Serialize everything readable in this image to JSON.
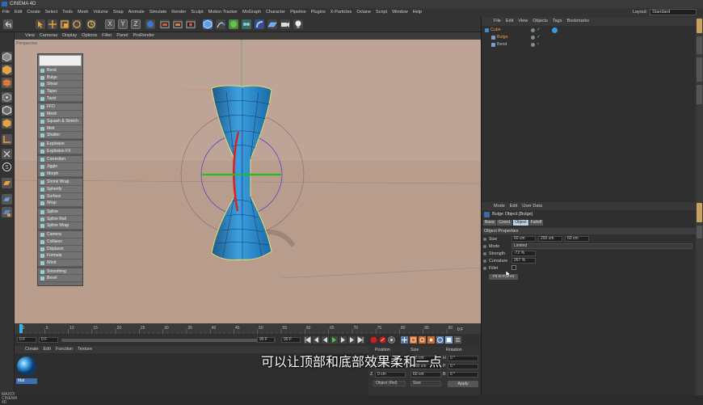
{
  "window": {
    "title": "CINEMA 4D"
  },
  "menubar": {
    "items": [
      "File",
      "Edit",
      "Create",
      "Select",
      "Tools",
      "Mesh",
      "Volume",
      "Snap",
      "Animate",
      "Simulate",
      "Render",
      "Sculpt",
      "Motion Tracker",
      "MoGraph",
      "Character",
      "Pipeline",
      "Plugins",
      "X-Particles",
      "Octane",
      "Script",
      "Window",
      "Help"
    ],
    "layout_label": "Layout:",
    "layout_value": "Standard"
  },
  "toolbar": {
    "axis_x": "X",
    "axis_y": "Y",
    "axis_z": "Z"
  },
  "viewport": {
    "menu": [
      "View",
      "Cameras",
      "Display",
      "Options",
      "Filter",
      "Panel",
      "ProRender"
    ],
    "label": "Perspective"
  },
  "deformer_menu": {
    "groups": [
      [
        "Bend",
        "Bulge",
        "Shear",
        "Taper",
        "Twist"
      ],
      [
        "FFD",
        "Mesh",
        "Squash & Stretch",
        "Melt",
        "Shatter"
      ],
      [
        "Explosion",
        "Explosion FX"
      ],
      [
        "Correction",
        "Jiggle",
        "Morph"
      ],
      [
        "Shrink Wrap",
        "Spherify",
        "Surface",
        "Wrap"
      ],
      [
        "Spline",
        "Spline Rail",
        "Spline Wrap"
      ],
      [
        "Camera",
        "Collision",
        "Displacer",
        "Formula",
        "Wind"
      ],
      [
        "Smoothing",
        "Bevel"
      ]
    ]
  },
  "timeline": {
    "ticks": [
      "0",
      "5",
      "10",
      "15",
      "20",
      "25",
      "30",
      "35",
      "40",
      "45",
      "50",
      "55",
      "60",
      "65",
      "70",
      "75",
      "80",
      "85",
      "90"
    ],
    "end_label": "0 F",
    "start_field": "0 F",
    "min_field": "0 F",
    "max_field": "90 F",
    "end_field": "90 F"
  },
  "materials": {
    "menu": [
      "Create",
      "Edit",
      "Function",
      "Texture"
    ],
    "swatch_label": "Mat"
  },
  "coords": {
    "headers": [
      "Position",
      "Size",
      "Rotation"
    ],
    "rows": [
      {
        "axis": "X",
        "pos": "0 cm",
        "size": "60 cm",
        "rot_axis": "H",
        "rot": "0 °"
      },
      {
        "axis": "Y",
        "pos": "0 cm",
        "size": "200 cm",
        "rot_axis": "P",
        "rot": "0 °"
      },
      {
        "axis": "Z",
        "pos": "0 cm",
        "size": "60 cm",
        "rot_axis": "B",
        "rot": "0 °"
      }
    ],
    "mode": "Object (Rel)",
    "size_mode": "Size",
    "apply_label": "Apply"
  },
  "object_manager": {
    "menu": [
      "File",
      "Edit",
      "View",
      "Objects",
      "Tags",
      "Bookmarks"
    ],
    "objects": [
      {
        "name": "Cube",
        "indent": 0,
        "color": "#e8a040"
      },
      {
        "name": "Bulge",
        "indent": 1,
        "color": "#e8a040"
      },
      {
        "name": "Bend",
        "indent": 1,
        "color": "#aabbdd"
      }
    ]
  },
  "attributes": {
    "menu": [
      "Mode",
      "Edit",
      "User Data"
    ],
    "title": "Bulge Object [Bulge]",
    "tabs": [
      "Basic",
      "Coord.",
      "Object",
      "Falloff"
    ],
    "active_tab": "Object",
    "section": "Object Properties",
    "props": {
      "size_label": "Size",
      "size_x": "60 cm",
      "size_y": "200 cm",
      "size_z": "60 cm",
      "mode_label": "Mode",
      "mode_value": "Limited",
      "strength_label": "Strength",
      "strength_value": "-72 %",
      "curvature_label": "Curvature",
      "curvature_value": "267 %",
      "fillet_label": "Fillet"
    },
    "fit_button": "Fit to Parent"
  },
  "branding": {
    "maxon": "MAXON CINEMA 4D"
  },
  "subtitle": "可以让顶部和底部效果柔和一点",
  "colors": {
    "viewport_bg": "#b99d8c",
    "mesh_blue": "#2e8fd0",
    "accent_orange": "#e8a040",
    "active_tab": "#bdd1e8"
  }
}
